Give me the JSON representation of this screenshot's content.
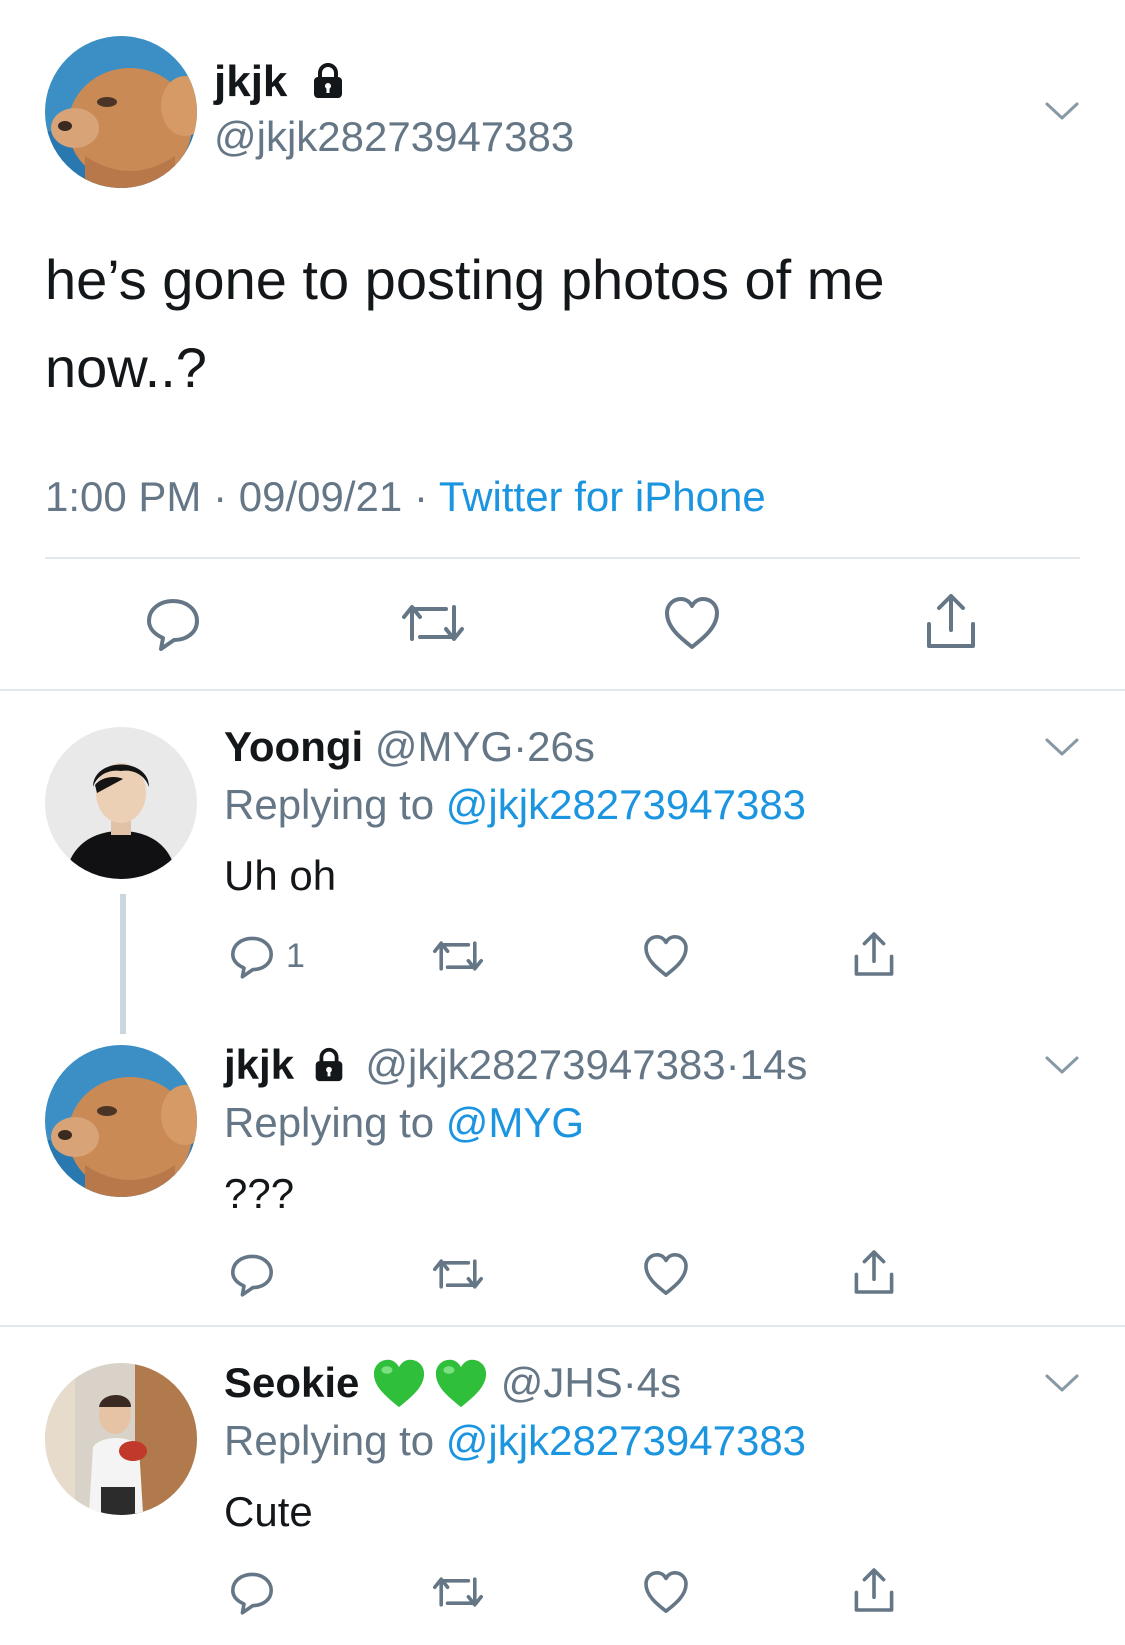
{
  "main_tweet": {
    "display_name": "jkjk",
    "handle": "@jkjk28273947383",
    "text_line1": "he’s gone to posting photos of me",
    "text_line2": "now..?",
    "time": "1:00 PM",
    "date": "09/09/21",
    "separator": "·",
    "source": "Twitter for iPhone"
  },
  "replies": [
    {
      "display_name": "Yoongi",
      "handle": "@MYG",
      "age": "26s",
      "replying_label": "Replying to",
      "replying_to": "@jkjk28273947383",
      "text": "Uh oh",
      "reply_count": "1"
    },
    {
      "display_name": "jkjk",
      "handle": "@jkjk28273947383",
      "age": "14s",
      "replying_label": "Replying to",
      "replying_to": "@MYG",
      "text": "???",
      "reply_count": ""
    },
    {
      "display_name": "Seokie",
      "handle": "@JHS",
      "age": "4s",
      "replying_label": "Replying to",
      "replying_to": "@jkjk28273947383",
      "text": "Cute",
      "reply_count": ""
    }
  ],
  "dot": "·",
  "colors": {
    "text": "#14171a",
    "secondary": "#657786",
    "link": "#1b95e0",
    "divider": "#e1e8ed",
    "emoji_green": "#2fbf3a"
  },
  "icons": {
    "reply": "reply-icon",
    "retweet": "retweet-icon",
    "like": "heart-icon",
    "share": "share-icon",
    "chevron": "chevron-down-icon",
    "lock": "lock-icon"
  }
}
